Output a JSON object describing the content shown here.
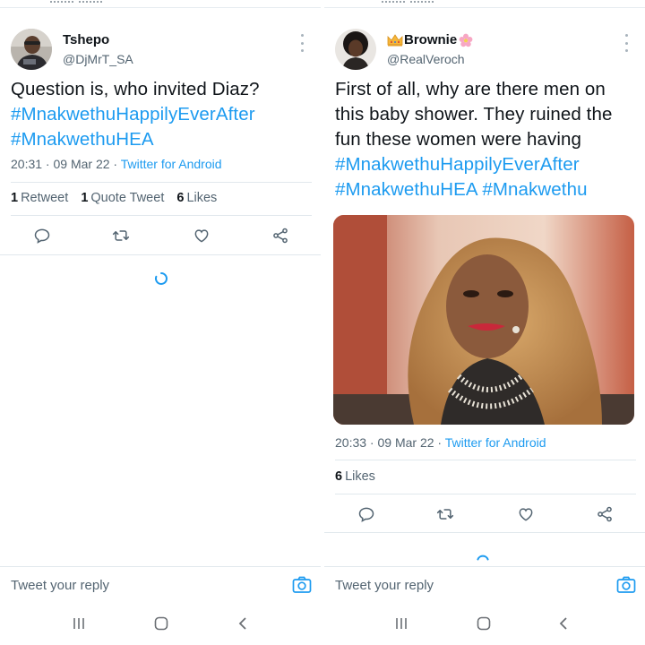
{
  "left_tweet": {
    "display_name": "Tshepo",
    "handle": "@DjMrT_SA",
    "text_lines": [
      {
        "text": "Question is, who invited Diaz?",
        "is_tag": false
      },
      {
        "text": "#MnakwethuHappilyEverAfter",
        "is_tag": true
      },
      {
        "text": "#MnakwethuHEA",
        "is_tag": true
      }
    ],
    "time": "20:31 · 09 Mar 22 · ",
    "source": "Twitter for Android",
    "stats": {
      "retweets_count": "1",
      "retweets_label": "Retweet",
      "quotes_count": "1",
      "quotes_label": "Quote Tweet",
      "likes_count": "6",
      "likes_label": "Likes"
    }
  },
  "right_tweet": {
    "display_name": "Brownie",
    "name_emoji_left": "crown-icon",
    "name_emoji_right": "flower-icon",
    "handle": "@RealVeroch",
    "text_lines": [
      {
        "text": "First of all, why are there men on",
        "is_tag": false
      },
      {
        "text": "this baby shower. They ruined the",
        "is_tag": false
      },
      {
        "text": "fun these women were having",
        "is_tag": false
      },
      {
        "text": "#MnakwethuHappilyEverAfter",
        "is_tag": true
      },
      {
        "text": "#MnakwethuHEA #Mnakwethu",
        "is_tag": true
      }
    ],
    "time": "20:33 · 09 Mar 22 · ",
    "source": "Twitter for Android",
    "stats": {
      "likes_count": "6",
      "likes_label": "Likes"
    }
  },
  "reply": {
    "placeholder": "Tweet your reply"
  },
  "colors": {
    "link": "#1d9bf0",
    "text": "#0f1419",
    "secondary": "#536471",
    "divider": "#e1e8ed"
  },
  "icons": {
    "actions": [
      "reply-icon",
      "retweet-icon",
      "like-icon",
      "share-icon"
    ],
    "nav": [
      "recents-icon",
      "home-icon",
      "back-icon"
    ]
  }
}
